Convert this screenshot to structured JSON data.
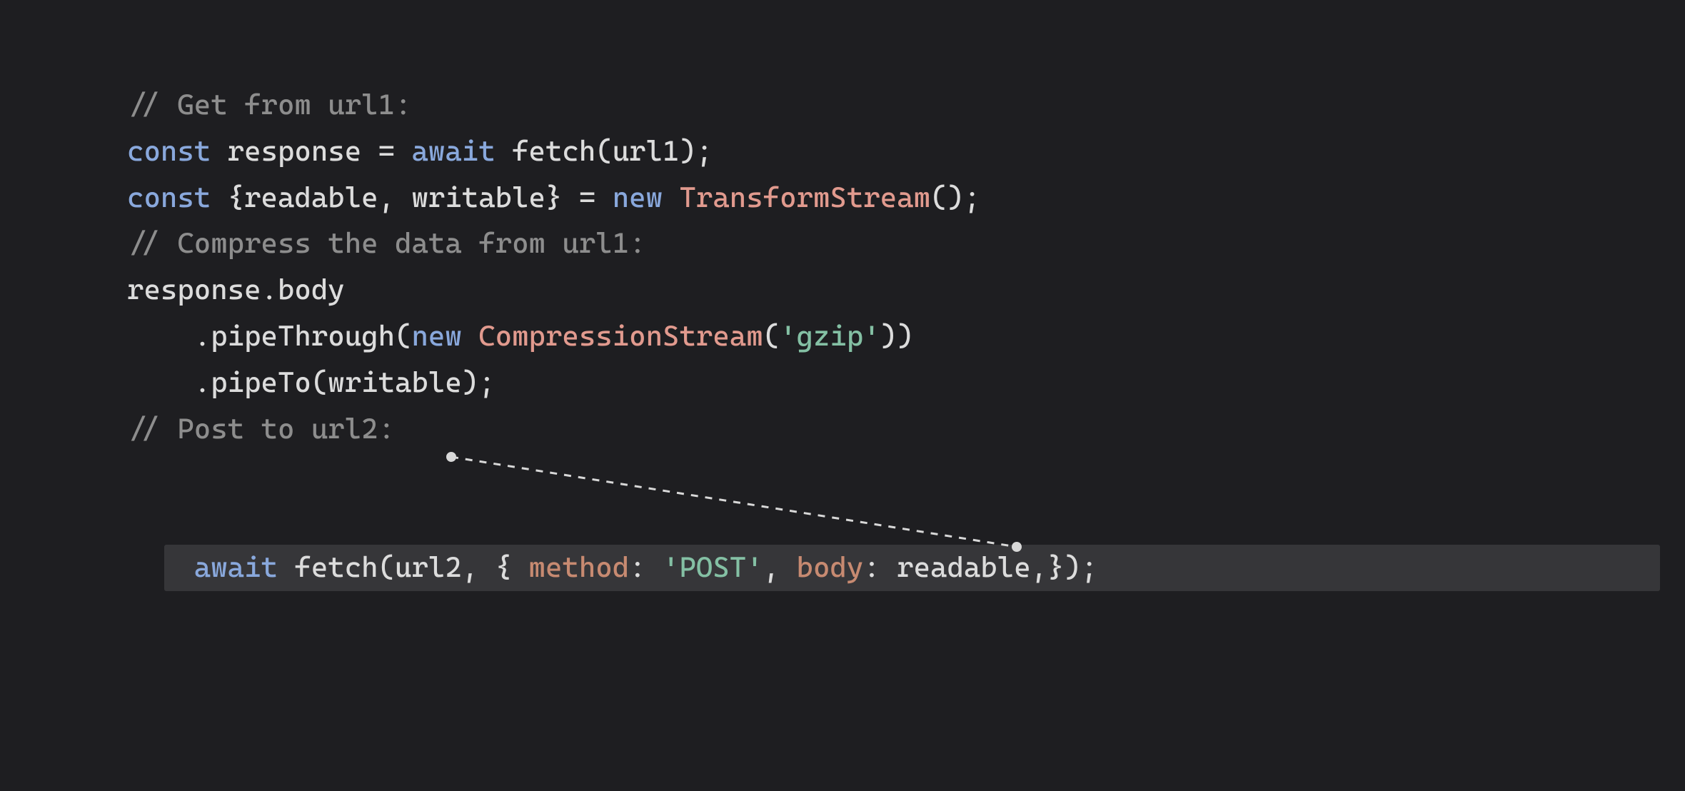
{
  "code": {
    "l1": {
      "comment": "// Get from url1:"
    },
    "l2": {
      "kw1": "const",
      "ident1": " response = ",
      "kw2": "await",
      "ident2": " fetch(url1);"
    },
    "l3": {
      "kw1": "const",
      "ident1": " {readable, writable} = ",
      "kw2": "new",
      "space": " ",
      "cls": "TransformStream",
      "ident2": "();"
    },
    "empty": "",
    "l5": {
      "comment": "// Compress the data from url1:"
    },
    "l6": {
      "text": "response.body"
    },
    "l7": {
      "indent": "    ",
      "before": ".pipeThrough(",
      "kw": "new",
      "space": " ",
      "cls": "CompressionStream",
      "paren": "(",
      "str": "'gzip'",
      "after": "))"
    },
    "l8": {
      "indent": "    ",
      "text": ".pipeTo(writable);"
    },
    "l10": {
      "comment": "// Post to url2:"
    },
    "l11": {
      "kw": "await",
      "before": " fetch(url2, { ",
      "prop1": "method",
      "colon1": ": ",
      "str": "'POST'",
      "comma1": ", ",
      "prop2": "body",
      "colon2": ": ",
      "val": "readable",
      "after": ",});"
    }
  }
}
